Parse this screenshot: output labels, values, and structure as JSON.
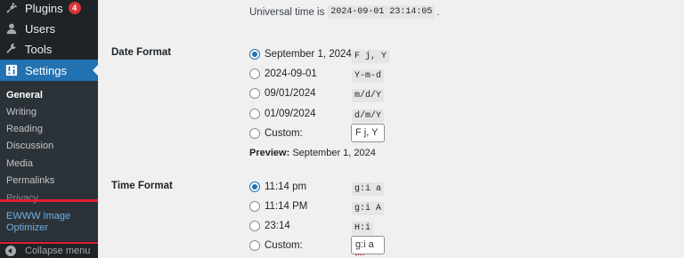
{
  "sidebar": {
    "menu": [
      {
        "label": "Plugins",
        "icon": "plug-icon",
        "badge": "4"
      },
      {
        "label": "Users",
        "icon": "user-icon"
      },
      {
        "label": "Tools",
        "icon": "wrench-icon"
      },
      {
        "label": "Settings",
        "icon": "settings-icon",
        "active": true
      }
    ],
    "submenu": [
      {
        "label": "General",
        "current": true
      },
      {
        "label": "Writing"
      },
      {
        "label": "Reading"
      },
      {
        "label": "Discussion"
      },
      {
        "label": "Media"
      },
      {
        "label": "Permalinks"
      },
      {
        "label": "Privacy"
      },
      {
        "label": "EWWW Image"
      },
      {
        "label": "Optimizer"
      }
    ],
    "collapse_label": "Collapse menu"
  },
  "utc": {
    "prefix": "Universal time is",
    "value": "2024-09-01 23:14:05",
    "suffix": "."
  },
  "date_format": {
    "label": "Date Format",
    "options": [
      {
        "label": "September 1, 2024",
        "code": "F j, Y",
        "checked": true
      },
      {
        "label": "2024-09-01",
        "code": "Y-m-d"
      },
      {
        "label": "09/01/2024",
        "code": "m/d/Y"
      },
      {
        "label": "01/09/2024",
        "code": "d/m/Y"
      },
      {
        "label": "Custom:",
        "input": "F j, Y"
      }
    ],
    "preview_label": "Preview:",
    "preview_value": "September 1, 2024"
  },
  "time_format": {
    "label": "Time Format",
    "options": [
      {
        "label": "11:14 pm",
        "code": "g:i a",
        "checked": true
      },
      {
        "label": "11:14 PM",
        "code": "g:i A"
      },
      {
        "label": "23:14",
        "code": "H:i"
      },
      {
        "label": "Custom:",
        "input": "g:i a"
      }
    ]
  },
  "colors": {
    "sidebar_bg": "#1d2327",
    "accent": "#2271b1",
    "badge": "#d63638",
    "highlight_box": "#e1202e"
  }
}
